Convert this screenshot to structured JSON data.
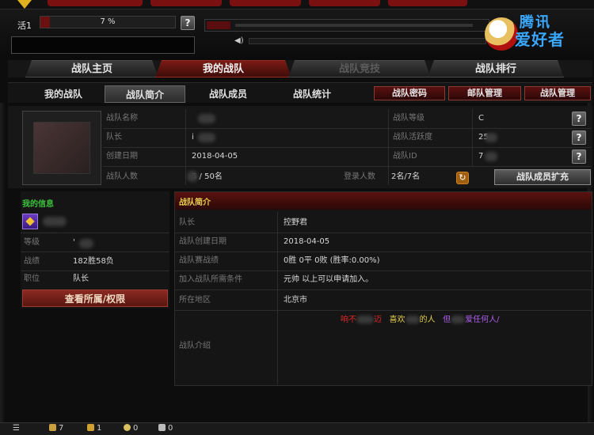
{
  "topbar": {
    "level_label": "活1",
    "xp_text": "7 %",
    "xp_progress": 0.07,
    "help_label": "?",
    "brand_title": "腾讯",
    "brand_subtitle": "爱好者"
  },
  "main_tabs": [
    {
      "label": "战队主页",
      "state": "normal"
    },
    {
      "label": "我的战队",
      "state": "active"
    },
    {
      "label": "战队竞技",
      "state": "disabled"
    },
    {
      "label": "战队排行",
      "state": "normal"
    }
  ],
  "sub_tabs": [
    {
      "label": "我的战队",
      "active": false
    },
    {
      "label": "战队简介",
      "active": true
    },
    {
      "label": "战队成员",
      "active": false
    },
    {
      "label": "战队统计",
      "active": false
    }
  ],
  "actions": [
    "战队密码",
    "邮队管理",
    "战队管理"
  ],
  "team_info": {
    "name_label": "战队名称",
    "name_value": "",
    "leader_label": "队长",
    "leader_value": "i",
    "created_label": "创建日期",
    "created_value": "2018-04-05",
    "members_label": "战队人数",
    "members_value": "5 / 50名",
    "level_label": "战队等级",
    "level_value": "C",
    "activity_label": "战队活跃度",
    "activity_value": "25",
    "id_label": "战队ID",
    "id_value": "7",
    "login_label": "登录人数",
    "login_value": "2名/7名",
    "expand_label": "战队成员扩充"
  },
  "my_info": {
    "title": "我的信息",
    "rank_label": "等级",
    "rank_value": "'",
    "record_label": "战绩",
    "record_value": "182胜58负",
    "duty_label": "职位",
    "duty_value": "队长",
    "view_button": "查看所属/权限"
  },
  "intro": {
    "title": "战队简介",
    "rows": [
      {
        "label": "队长",
        "value": "控野君"
      },
      {
        "label": "战队创建日期",
        "value": "2018-04-05"
      },
      {
        "label": "战队赛战绩",
        "value": "0胜 0平 0败 (胜率:0.00%)"
      },
      {
        "label": "加入战队所需条件",
        "value": "元帅 以上可以申请加入。"
      },
      {
        "label": "所在地区",
        "value": "北京市"
      }
    ],
    "desc_label": "战队介绍",
    "desc_part1": "响不",
    "desc_part2": "迈",
    "desc_part3": "喜欢",
    "desc_part4": "的人",
    "desc_part5": "但",
    "desc_part6": "爱任何人/",
    "colors": {
      "red": "#e02828",
      "yellow": "#e8d050",
      "purple": "#b060f0"
    }
  },
  "bottom": {
    "item1": "7",
    "item2": "1",
    "item3": "0",
    "item4": "0"
  }
}
